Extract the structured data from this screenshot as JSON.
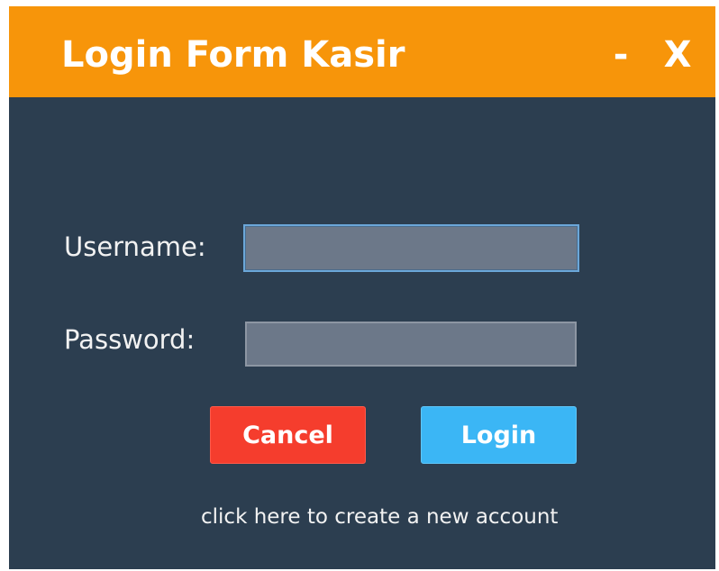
{
  "window": {
    "title": "Login Form Kasir",
    "minimize_label": "-",
    "close_label": "X"
  },
  "form": {
    "username_label": "Username:",
    "username_value": "",
    "password_label": "Password:",
    "password_value": ""
  },
  "buttons": {
    "cancel_label": "Cancel",
    "login_label": "Login"
  },
  "links": {
    "create_account": "click here to create a new account"
  },
  "colors": {
    "titlebar": "#f7950a",
    "background": "#2c3e50",
    "cancel": "#f53d2d",
    "login": "#3bb6f5"
  }
}
